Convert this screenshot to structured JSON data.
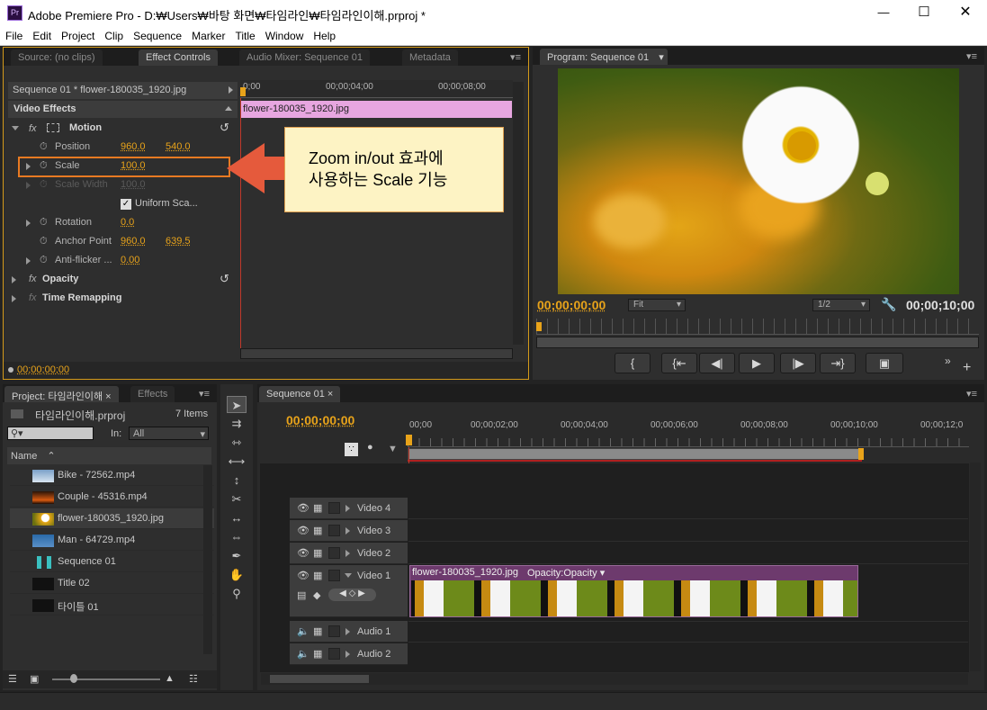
{
  "window": {
    "title": "Adobe Premiere Pro - D:₩Users₩바탕 화면₩타임라인₩타임라인이해.prproj *",
    "icon": "Pr"
  },
  "menu": [
    "File",
    "Edit",
    "Project",
    "Clip",
    "Sequence",
    "Marker",
    "Title",
    "Window",
    "Help"
  ],
  "source_panel": {
    "tabs": [
      "Source: (no clips)",
      "Effect Controls",
      "Audio Mixer: Sequence 01",
      "Metadata"
    ],
    "clip_header": "Sequence 01 * flower-180035_1920.jpg",
    "ruler": [
      "0;00",
      "00;00;04;00",
      "00;00;08;00"
    ],
    "clip_bar": "flower-180035_1920.jpg",
    "section": "Video Effects",
    "motion": "Motion",
    "rows": [
      {
        "label": "Position",
        "v1": "960.0",
        "v2": "540.0"
      },
      {
        "label": "Scale",
        "v1": "100.0"
      },
      {
        "label": "Scale Width",
        "v1": "100.0"
      },
      {
        "label": "Uniform Sca..."
      },
      {
        "label": "Rotation",
        "v1": "0.0"
      },
      {
        "label": "Anchor Point",
        "v1": "960.0",
        "v2": "639.5"
      },
      {
        "label": "Anti-flicker ...",
        "v1": "0.00"
      }
    ],
    "opacity": "Opacity",
    "time_remap": "Time Remapping",
    "timecode": "00;00;00;00",
    "callout": [
      "Zoom in/out 효과에",
      "사용하는 Scale 기능"
    ]
  },
  "program_panel": {
    "tab": "Program: Sequence 01",
    "timecode_left": "00;00;00;00",
    "fit": "Fit",
    "res": "1/2",
    "timecode_right": "00;00;10;00"
  },
  "project_panel": {
    "tabs": [
      "Project: 타임라인이해",
      "Effects"
    ],
    "name": "타임라인이해.prproj",
    "count": "7 Items",
    "in_label": "In:",
    "in_value": "All",
    "col_name": "Name",
    "items": [
      "Bike - 72562.mp4",
      "Couple - 45316.mp4",
      "flower-180035_1920.jpg",
      "Man - 64729.mp4",
      "Sequence 01",
      "Title 02",
      "타이틀 01"
    ]
  },
  "timeline": {
    "tab": "Sequence 01",
    "timecode": "00;00;00;00",
    "ruler": [
      "00;00",
      "00;00;02;00",
      "00;00;04;00",
      "00;00;06;00",
      "00;00;08;00",
      "00;00;10;00",
      "00;00;12;0"
    ],
    "tracks": [
      "Video 4",
      "Video 3",
      "Video 2",
      "Video 1",
      "Audio 1",
      "Audio 2"
    ],
    "clip_name": "flower-180035_1920.jpg",
    "clip_fx": "Opacity:Opacity"
  },
  "colors": {
    "accent": "#e8a31a",
    "clip_pink": "#e7a6e0",
    "clip_purple": "#6d3a6d",
    "callout_bg": "#fdf3c4",
    "arrow": "#e55a3c"
  }
}
